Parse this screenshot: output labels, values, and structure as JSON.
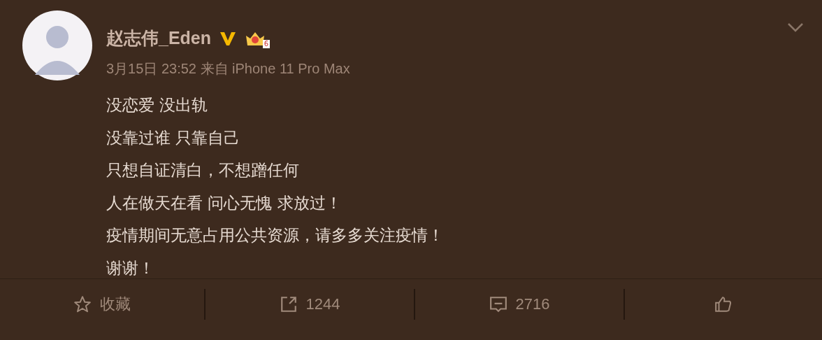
{
  "author": {
    "name": "赵志伟_Eden",
    "meta": "3月15日 23:52 来自 iPhone 11 Pro Max",
    "vip_level": "6"
  },
  "post": {
    "lines": [
      "没恋爱 没出轨",
      "没靠过谁  只靠自己",
      "只想自证清白，不想蹭任何",
      "人在做天在看   问心无愧  求放过！",
      "疫情期间无意占用公共资源，请多多关注疫情！",
      "谢谢！"
    ]
  },
  "actions": [
    {
      "kind": "favorite",
      "label": "收藏"
    },
    {
      "kind": "repost",
      "label": "1244"
    },
    {
      "kind": "comment",
      "label": "2716"
    },
    {
      "kind": "like"
    }
  ]
}
